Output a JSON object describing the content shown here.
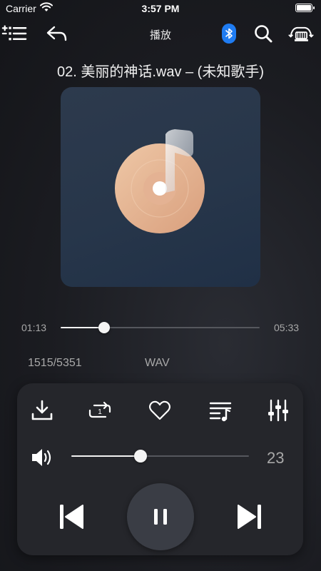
{
  "status_bar": {
    "carrier": "Carrier",
    "time": "3:57 PM",
    "battery_level": 1.0
  },
  "nav_bar": {
    "title": "播放",
    "icons": {
      "left": [
        "playlist-menu-icon",
        "back-arrow-icon"
      ],
      "right": [
        "bluetooth-icon",
        "search-icon",
        "car-mode-icon"
      ]
    },
    "bluetooth_color": "#1f7cf2"
  },
  "track": {
    "title": "02. 美丽的神话.wav – (未知歌手)",
    "artwork_icon": "music-disc-icon",
    "artwork_colors": {
      "background": "#27364a",
      "disc": "#e8b894"
    }
  },
  "progress": {
    "elapsed": "01:13",
    "total": "05:33",
    "fraction": 0.22
  },
  "meta": {
    "track_index": "1515/5351",
    "format": "WAV"
  },
  "actions": [
    {
      "name": "download-icon"
    },
    {
      "name": "repeat-one-icon",
      "badge": "1"
    },
    {
      "name": "heart-icon"
    },
    {
      "name": "queue-list-icon"
    },
    {
      "name": "equalizer-icon"
    }
  ],
  "volume": {
    "icon": "speaker-icon",
    "value": "23",
    "fraction": 0.39
  },
  "transport": {
    "previous_icon": "skip-previous-icon",
    "play_pause_icon": "pause-icon",
    "next_icon": "skip-next-icon"
  }
}
